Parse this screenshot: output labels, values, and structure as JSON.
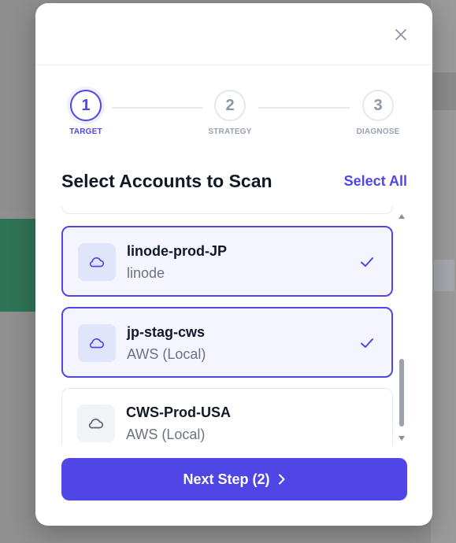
{
  "stepper": {
    "steps": [
      {
        "number": "1",
        "label": "TARGET",
        "state": "active"
      },
      {
        "number": "2",
        "label": "STRATEGY",
        "state": "idle"
      },
      {
        "number": "3",
        "label": "DIAGNOSE",
        "state": "idle"
      }
    ]
  },
  "section": {
    "title": "Select Accounts to Scan",
    "select_all_label": "Select All"
  },
  "accounts": [
    {
      "name": "linode-prod-JP",
      "provider": "linode",
      "selected": true,
      "icon": "cloud-icon"
    },
    {
      "name": "jp-stag-cws",
      "provider": "AWS (Local)",
      "selected": true,
      "icon": "cloud-icon"
    },
    {
      "name": "CWS-Prod-USA",
      "provider": "AWS (Local)",
      "selected": false,
      "icon": "cloud-icon"
    }
  ],
  "footer": {
    "next_label": "Next Step (2)"
  },
  "colors": {
    "accent": "#4f46e5",
    "selected_bg": "#f4f5ff",
    "text": "#111827",
    "muted": "#6b7280"
  }
}
